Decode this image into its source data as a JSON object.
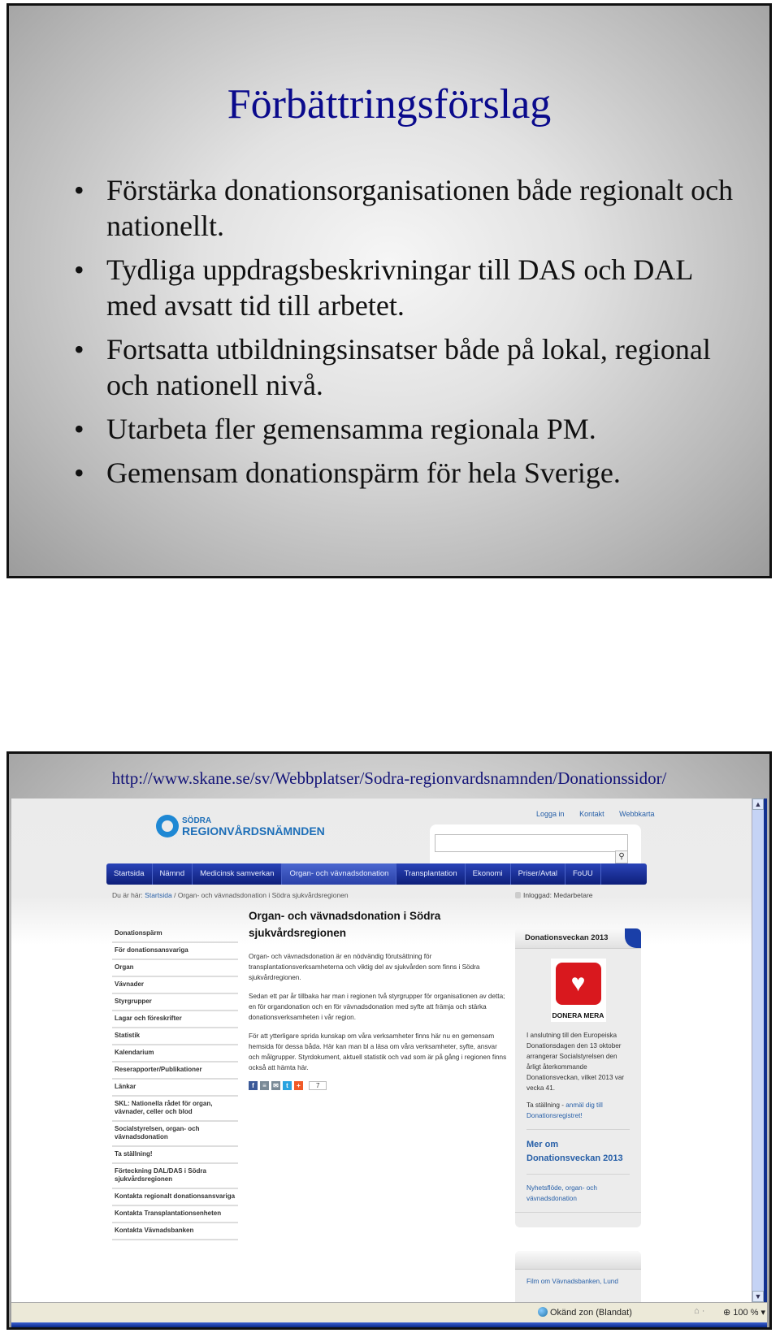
{
  "slide1": {
    "title": "Förbättringsförslag",
    "bullet_glyph": "•",
    "bullets": [
      "Förstärka donationsorganisationen både regionalt och nationellt.",
      "Tydliga uppdragsbeskrivningar till DAS och DAL med avsatt tid till arbetet.",
      "Fortsatta utbildningsinsatser både på lokal, regional och nationell nivå.",
      "Utarbeta fler gemensamma regionala PM.",
      "Gemensam donationspärm för hela Sverige."
    ]
  },
  "slide2": {
    "url_caption": "http://www.skane.se/sv/Webbplatser/Sodra-regionvardsnamnden/Donationssidor/",
    "site": {
      "logo": {
        "line1": "SÖDRA",
        "line2": "REGIONVÅRDSNÄMNDEN",
        "color": "#1e6fb8"
      },
      "top_links": [
        "Logga in",
        "Kontakt",
        "Webbkarta"
      ],
      "search": {
        "placeholder": "",
        "icon": "search-icon"
      },
      "nav": [
        {
          "label": "Startsida",
          "active": false
        },
        {
          "label": "Nämnd",
          "active": false
        },
        {
          "label": "Medicinsk samverkan",
          "active": false
        },
        {
          "label": "Organ- och vävnadsdonation",
          "active": true
        },
        {
          "label": "Transplantation",
          "active": false
        },
        {
          "label": "Ekonomi",
          "active": false
        },
        {
          "label": "Priser/Avtal",
          "active": false
        },
        {
          "label": "FoUU",
          "active": false
        }
      ],
      "breadcrumb": {
        "prefix": "Du är här:",
        "home": "Startsida",
        "separator": "/",
        "current": "Organ- och vävnadsdonation i Södra sjukvårdsregionen"
      },
      "logged_in": "Inloggad: Medarbetare",
      "sidenav": [
        "Donationspärm",
        "För donationsansvariga",
        "Organ",
        "Vävnader",
        "Styrgrupper",
        "Lagar och föreskrifter",
        "Statistik",
        "Kalendarium",
        "Reserapporter/Publikationer",
        "Länkar",
        "SKL: Nationella rådet för organ, vävnader, celler och blod",
        "Socialstyrelsen, organ- och vävnadsdonation",
        "Ta ställning!",
        "Förteckning DAL/DAS i Södra sjukvårdsregionen",
        "Kontakta regionalt donationsansvariga",
        "Kontakta Transplantationsenheten",
        "Kontakta Vävnadsbanken"
      ],
      "article": {
        "title": "Organ- och vävnadsdonation i Södra sjukvårdsregionen",
        "paragraphs": [
          "Organ- och vävnadsdonation är en nödvändig förutsättning för transplantationsverksamheterna och viktig del av sjukvården som finns i Södra sjukvårdregionen.",
          "Sedan ett par år tillbaka har man i regionen två styrgrupper för organisationen av detta; en för organdonation och en för vävnadsdonation med syfte att främja och stärka donationsverksamheten i vår region.",
          "För att ytterligare sprida kunskap om våra verksamheter finns här nu en gemensam hemsida för dessa båda. Här kan man bl a läsa om våra verksamheter, syfte, ansvar och målgrupper. Styrdokument, aktuell statistik och vad som är på gång i regionen finns också att hämta här."
        ],
        "share": [
          {
            "icon": "facebook-icon",
            "glyph": "f",
            "color": "#3b5998"
          },
          {
            "icon": "comment-icon",
            "glyph": "≡",
            "color": "#7a8a96"
          },
          {
            "icon": "email-icon",
            "glyph": "✉",
            "color": "#7a8a96"
          },
          {
            "icon": "twitter-icon",
            "glyph": "t",
            "color": "#2aa3e0"
          },
          {
            "icon": "plus-icon",
            "glyph": "+",
            "color": "#f05a28"
          }
        ],
        "share_count": "7"
      },
      "sidebox": {
        "title": "Donationsveckan 2013",
        "logo_text": "DONERA MERA",
        "logo_glyph": "♥",
        "text": "I anslutning till den Europeiska Donationsdagen den 13 oktober arrangerar Socialstyrelsen den årligt återkommande Donationsveckan, vilket 2013 var vecka 41.",
        "cta_prefix": "Ta ställning - ",
        "cta_link": "anmäl dig till Donationsregistret!",
        "more_link": "Mer om Donationsveckan 2013",
        "feed_link": "Nyhetsflöde, organ- och vävnadsdonation"
      },
      "sidebox2": {
        "item": "Film om Vävnadsbanken, Lund"
      }
    },
    "browser": {
      "scroll_up": "▲",
      "scroll_down": "▼",
      "status_zone": "Okänd zon (Blandat)",
      "status_security": "⌂ ·",
      "zoom": "100 %",
      "zoom_caret": "▾"
    }
  }
}
